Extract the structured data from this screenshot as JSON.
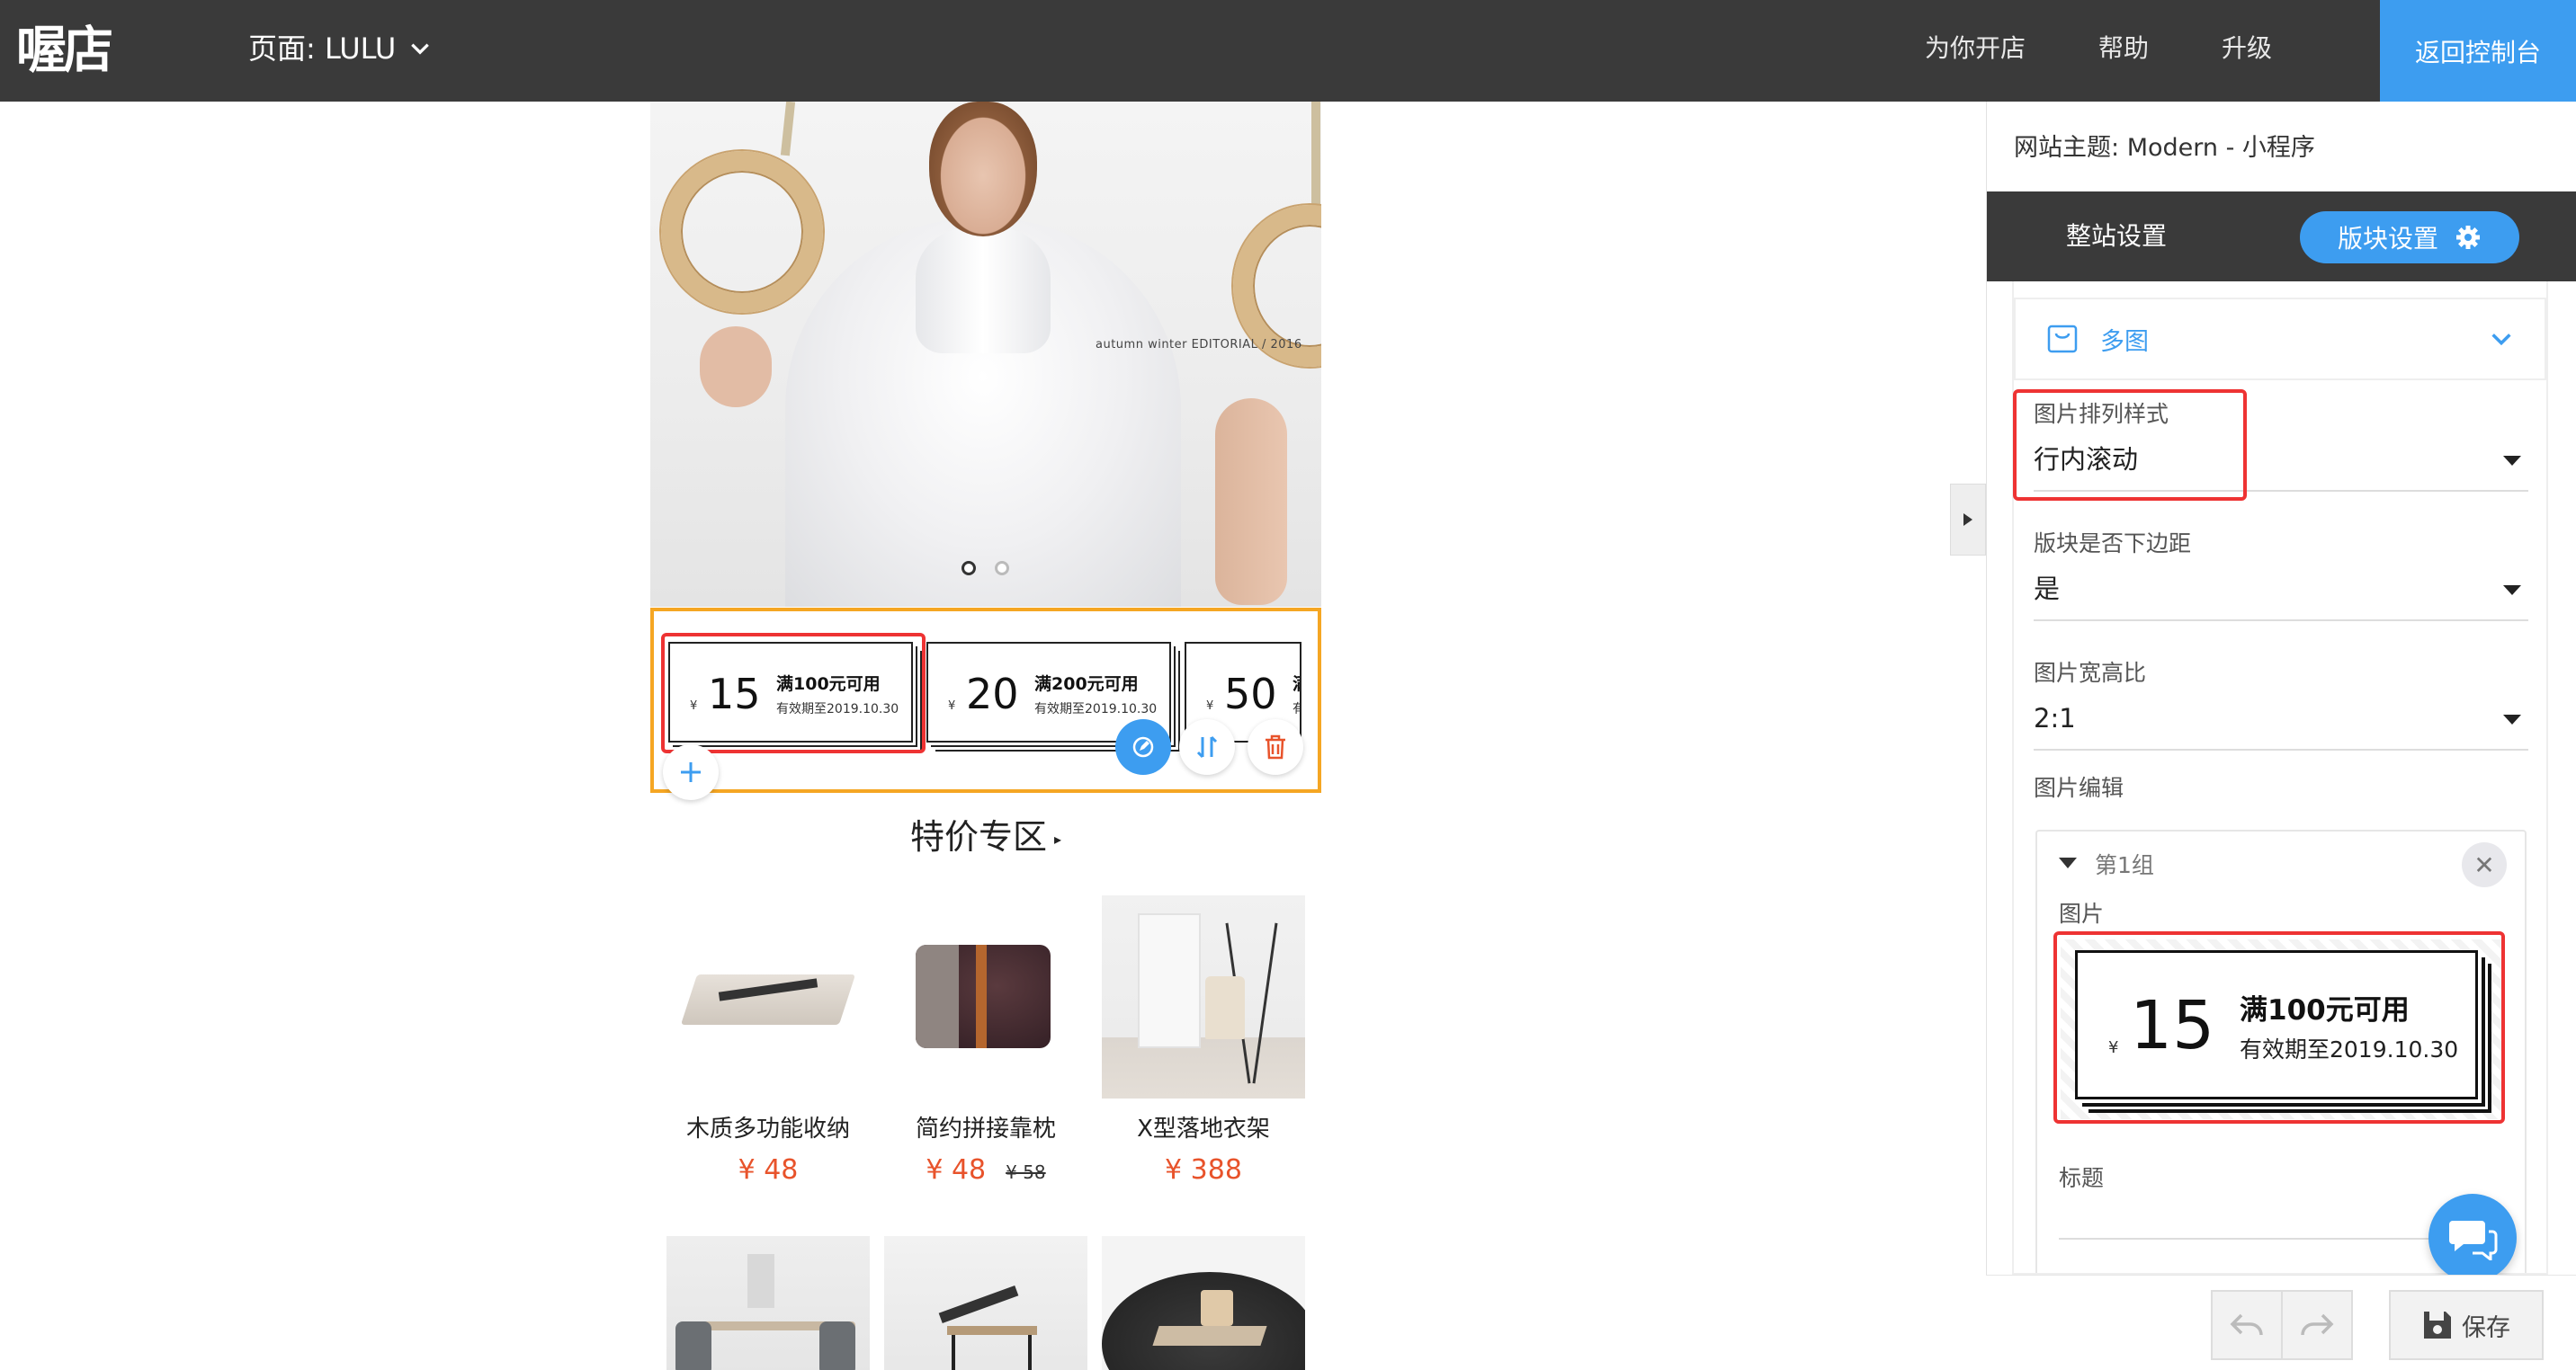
{
  "topbar": {
    "logo": "喔店",
    "page_selector": "页面: LULU",
    "nav": [
      "为你开店",
      "帮助",
      "升级"
    ],
    "back_button": "返回控制台"
  },
  "preview": {
    "hero_caption": "autumn winter EDITORIAL / 2016",
    "carousel_dots": 2,
    "coupons": [
      {
        "currency": "¥",
        "amount": "15",
        "title": "满100元可用",
        "valid": "有效期至2019.10.30"
      },
      {
        "currency": "¥",
        "amount": "20",
        "title": "满200元可用",
        "valid": "有效期至2019.10.30"
      },
      {
        "currency": "¥",
        "amount": "50",
        "title": "满",
        "valid": "有"
      }
    ],
    "section_title": "特价专区",
    "products": [
      {
        "name": "木质多功能收纳",
        "price": "¥ 48",
        "old_price": ""
      },
      {
        "name": "简约拼接靠枕",
        "price": "¥ 48",
        "old_price": "¥ 58"
      },
      {
        "name": "X型落地衣架",
        "price": "¥ 388",
        "old_price": ""
      }
    ]
  },
  "panel": {
    "theme_label": "网站主题:",
    "theme_value": "Modern - 小程序",
    "tabs": [
      "整站设置",
      "版块设置"
    ],
    "accordion_label": "多图",
    "fields": [
      {
        "label": "图片排列样式",
        "value": "行内滚动"
      },
      {
        "label": "版块是否下边距",
        "value": "是"
      },
      {
        "label": "图片宽高比",
        "value": "2:1"
      }
    ],
    "image_edit_label": "图片编辑",
    "group": {
      "name": "第1组",
      "image_label": "图片",
      "coupon": {
        "currency": "¥",
        "amount": "15",
        "title": "满100元可用",
        "valid": "有效期至2019.10.30"
      },
      "title_label": "标题",
      "title_value": ""
    },
    "save_label": "保存"
  },
  "colors": {
    "accent": "#3d9df0",
    "highlight": "#e33333",
    "selection": "#f5a623",
    "price": "#e8532b",
    "topbar": "#3a3a3a"
  }
}
